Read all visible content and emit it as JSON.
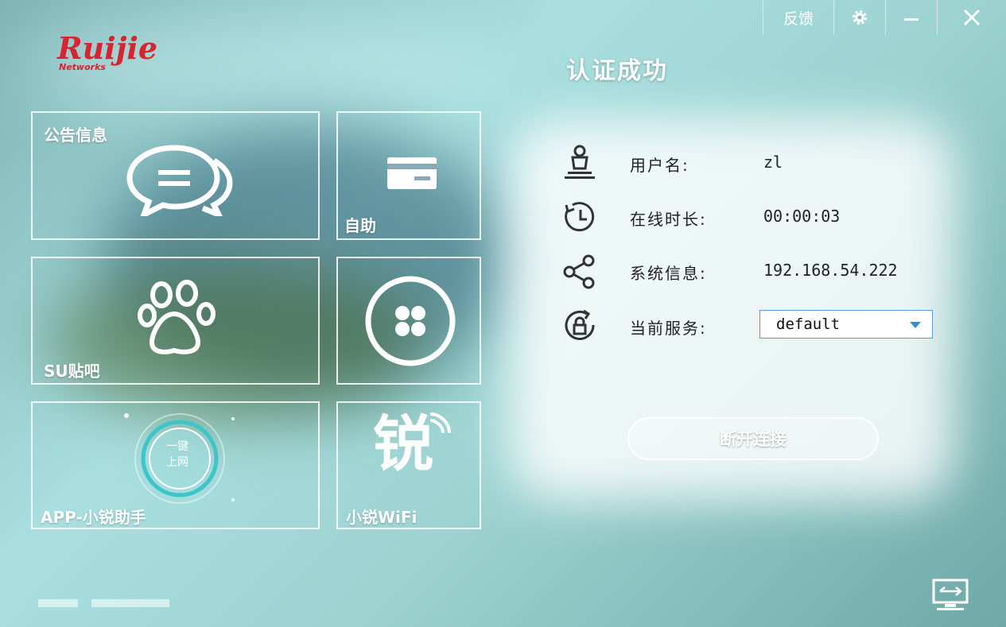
{
  "titlebar": {
    "feedback_label": "反馈",
    "settings_icon": "gear-icon",
    "minimize_icon": "minimize-icon",
    "close_icon": "close-icon"
  },
  "logo": {
    "brand": "Ruijie",
    "sub": "Networks",
    "color": "#d9232e"
  },
  "tiles": {
    "announcement": {
      "label": "公告信息",
      "icon": "chat-bubbles-icon"
    },
    "self_service": {
      "label": "自助",
      "icon": "card-icon"
    },
    "su_tieba": {
      "label": "SU贴吧",
      "icon": "paw-icon"
    },
    "clover": {
      "label": "",
      "icon": "clover-icon"
    },
    "app_assistant": {
      "label": "APP-小锐助手",
      "icon": "one-click-online-icon",
      "inner_text_1": "一键",
      "inner_text_2": "上网"
    },
    "xiaorui_wifi": {
      "label": "小锐WiFi",
      "icon": "rui-wifi-icon",
      "glyph": "锐"
    }
  },
  "status": {
    "title": "认证成功",
    "rows": [
      {
        "label": "用户名:",
        "value": "zl",
        "icon": "user-icon"
      },
      {
        "label": "在线时长:",
        "value": "00:00:03",
        "icon": "clock-icon"
      },
      {
        "label": "系统信息:",
        "value": "192.168.54.222",
        "icon": "share-icon"
      },
      {
        "label": "当前服务:",
        "value": "",
        "icon": "lock-refresh-icon"
      }
    ],
    "service_select": {
      "value": "default"
    },
    "disconnect_label": "断开连接"
  },
  "footer": {
    "network_icon": "network-monitor-icon"
  },
  "colors": {
    "accent": "#2f8fd8",
    "logo_red": "#d9232e"
  }
}
